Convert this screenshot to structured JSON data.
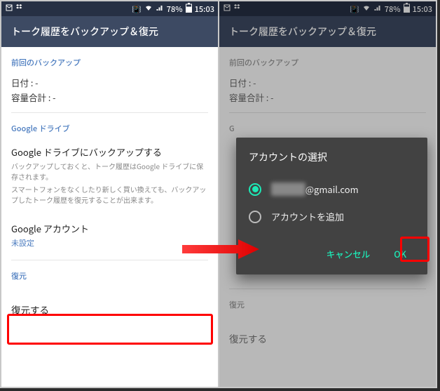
{
  "status": {
    "battery": "78%",
    "time": "15:03"
  },
  "header": {
    "title": "トーク履歴をバックアップ＆復元"
  },
  "sections": {
    "last_backup": {
      "title": "前回のバックアップ",
      "date_label": "日付",
      "date_value": ": -",
      "size_label": "容量合計",
      "size_value": ": -"
    },
    "gdrive": {
      "title": "Google ドライブ",
      "backup_title": "Google ドライブにバックアップする",
      "backup_desc1": "バックアップしておくと、トーク履歴はGoogle ドライブに保存されます。",
      "backup_desc2": "スマートフォンをなくしたり新しく買い換えても、バックアップしたトーク履歴を復元することが出来ます。",
      "account_title": "Google アカウント",
      "account_value": "未設定"
    },
    "restore": {
      "title": "復元",
      "action": "復元する"
    }
  },
  "dialog": {
    "title": "アカウントの選択",
    "account_masked": "XXXXXX",
    "account_domain": "@gmail.com",
    "add_account": "アカウントを追加",
    "cancel": "キャンセル",
    "ok": "OK"
  }
}
